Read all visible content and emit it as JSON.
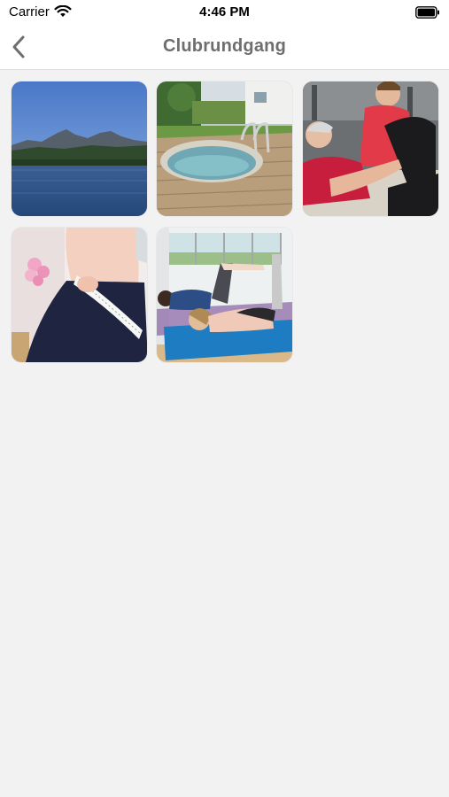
{
  "status_bar": {
    "carrier": "Carrier",
    "time": "4:46 PM",
    "icons": [
      "wifi-icon",
      "battery-icon"
    ]
  },
  "nav": {
    "title": "Clubrundgang",
    "back_icon": "chevron-left-icon",
    "title_color": "#6e6e6e"
  },
  "gallery": {
    "photos": [
      {
        "subject": "mountain-lake-photo"
      },
      {
        "subject": "outdoor-pool-photo"
      },
      {
        "subject": "fitness-training-photo"
      },
      {
        "subject": "waist-measuring-photo"
      },
      {
        "subject": "pilates-class-photo"
      }
    ]
  },
  "colors": {
    "background": "#f2f2f2",
    "bar": "#ffffff"
  }
}
